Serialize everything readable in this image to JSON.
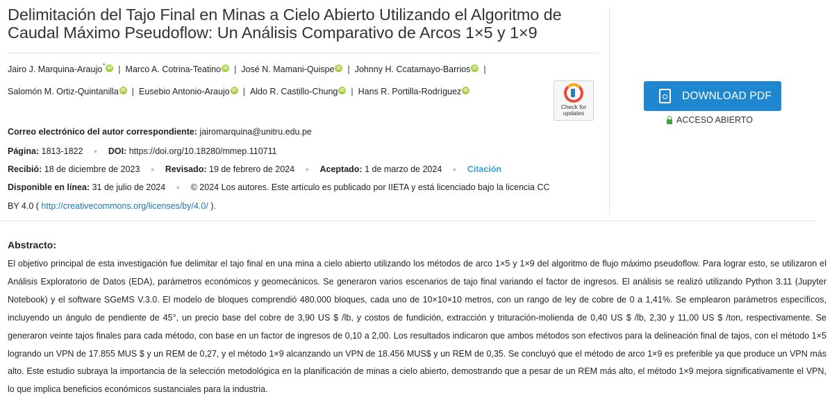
{
  "article": {
    "title": "Delimitación del Tajo Final en Minas a Cielo Abierto Utilizando el Algoritmo de Caudal Máximo Pseudoflow: Un Análisis Comparativo de Arcos 1×5 y 1×9",
    "authors": [
      "Jairo J. Marquina-Araujo",
      "Marco A. Cotrina-Teatino",
      "José N. Mamani-Quispe",
      "Johnny H. Ccatamayo-Barrios",
      "Salomón M. Ortiz-Quintanilla",
      "Eusebio Antonio-Araujo",
      "Aldo R. Castillo-Chung",
      "Hans R. Portilla-Rodríguez"
    ],
    "corresponding_mark": "*",
    "orcid_glyph": "iD",
    "separator": "|",
    "badge": {
      "line1": "Check for",
      "line2": "updates"
    }
  },
  "meta": {
    "email_label": "Correo electrónico del autor correspondiente:",
    "email": "jairomarquina@unitru.edu.pe",
    "page_label": "Página:",
    "page": "1813-1822",
    "doi_label": "DOI:",
    "doi": "https://doi.org/10.18280/mmep.110711",
    "received_label": "Recibió:",
    "received": "18 de diciembre de 2023",
    "revised_label": "Revisado:",
    "revised": "19 de febrero de 2024",
    "accepted_label": "Aceptado:",
    "accepted": "1 de marzo de 2024",
    "citation": "Citación",
    "online_label": "Disponible en línea:",
    "online": "31 de julio de 2024",
    "license_text": "© 2024 Los autores. Este artículo es publicado por IIETA y está licenciado bajo la licencia CC",
    "license_cont": "BY 4.0 (",
    "license_url": "http://creativecommons.org/licenses/by/4.0/",
    "license_end": ")."
  },
  "sidebar": {
    "download_label": "DOWNLOAD PDF",
    "access_label": "ACCESO ABIERTO"
  },
  "abstract": {
    "heading": "Abstracto:",
    "text": "El objetivo principal de esta investigación fue delimitar el tajo final en una mina a cielo abierto utilizando los métodos de arco 1×5 y 1×9 del algoritmo de flujo máximo pseudoflow. Para lograr esto, se utilizaron el Análisis Exploratorio de Datos (EDA), parámetros económicos y geomecánicos. Se generaron varios escenarios de tajo final variando el factor de ingresos. El análisis se realizó utilizando Python 3.11 (Jupyter Notebook) y el software SGeMS V.3.0. El modelo de bloques comprendió 480.000 bloques, cada uno de 10×10×10 metros, con un rango de ley de cobre de 0 a 1,41%. Se emplearon parámetros específicos, incluyendo un ángulo de pendiente de 45°, un precio base del cobre de 3,90 US $ /lb, y costos de fundición, extracción y trituración-molienda de 0,40 US $ /lb, 2,30 y 11,00 US $ /ton, respectivamente. Se generaron veinte tajos finales para cada método, con base en un factor de ingresos de 0,10 a 2,00. Los resultados indicaron que ambos métodos son efectivos para la delineación final de tajos, con el método 1×5 logrando un VPN de 17.855 MUS $ y un REM de 0,27, y el método 1×9 alcanzando un VPN de 18.456 MUS$ y un REM de 0,35. Se concluyó que el método de arco 1×9 es preferible ya que produce un VPN más alto. Este estudio subraya la importancia de la selección metodológica en la planificación de minas a cielo abierto, demostrando que a pesar de un REM más alto, el método 1×9 mejora significativamente el VPN, lo que implica beneficios económicos sustanciales para la industria."
  }
}
